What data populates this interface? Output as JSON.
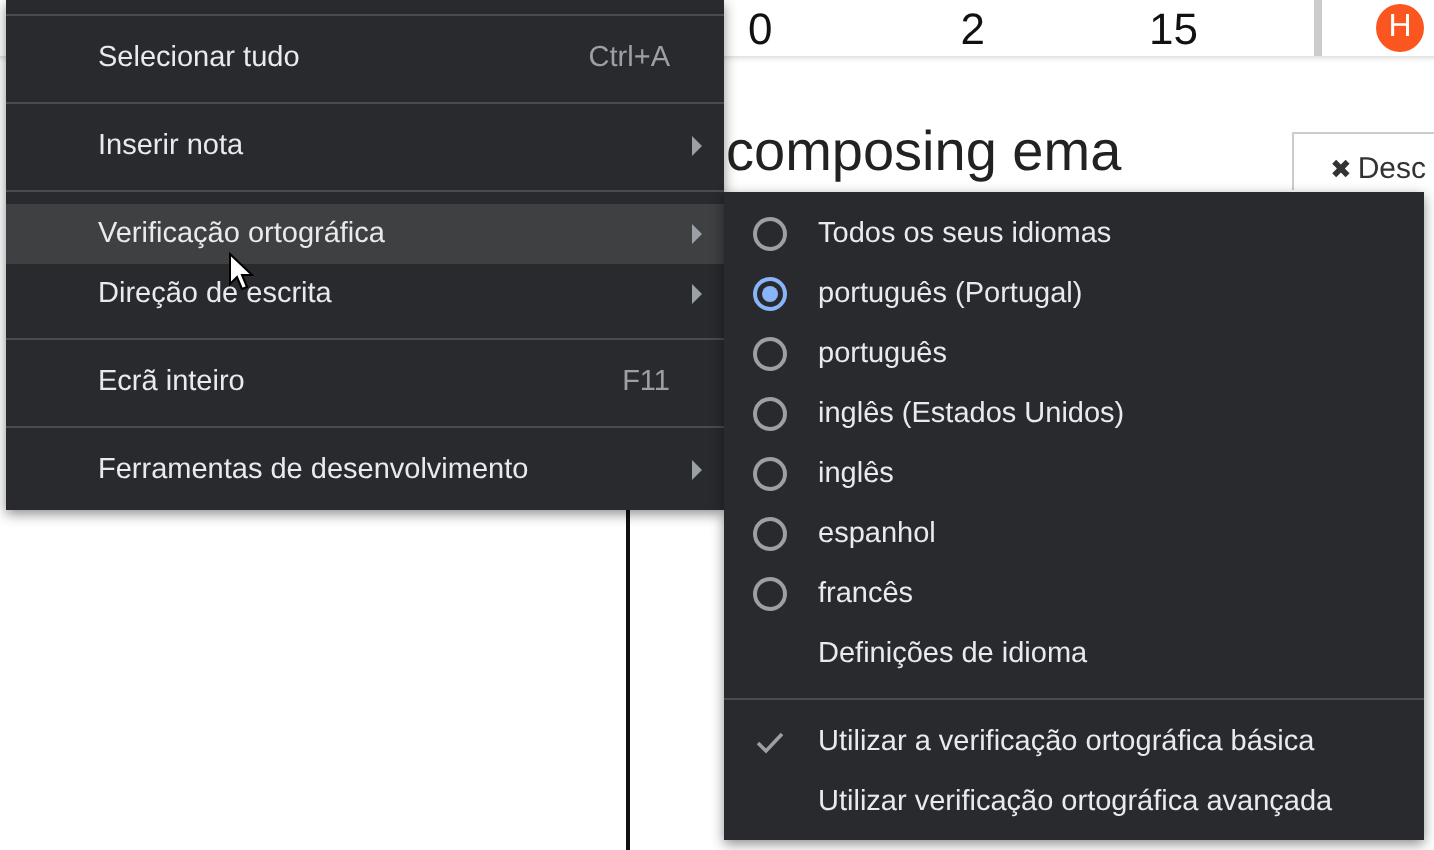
{
  "header": {
    "counters": [
      "0",
      "2",
      "15"
    ],
    "avatar": "H"
  },
  "heading": "composing ema",
  "discard_button": {
    "icon": "✖",
    "label": "Desc"
  },
  "context_menu": {
    "items": [
      {
        "kind": "separator"
      },
      {
        "kind": "item",
        "label": "Selecionar tudo",
        "shortcut": "Ctrl+A",
        "submenu": false,
        "highlighted": false
      },
      {
        "kind": "separator"
      },
      {
        "kind": "item",
        "label": "Inserir nota",
        "submenu": true,
        "highlighted": false
      },
      {
        "kind": "separator"
      },
      {
        "kind": "item",
        "label": "Verificação ortográfica",
        "submenu": true,
        "highlighted": true
      },
      {
        "kind": "item",
        "label": "Direção de escrita",
        "submenu": true,
        "highlighted": false
      },
      {
        "kind": "separator"
      },
      {
        "kind": "item",
        "label": "Ecrã inteiro",
        "shortcut": "F11",
        "submenu": false,
        "highlighted": false
      },
      {
        "kind": "separator"
      },
      {
        "kind": "item",
        "label": "Ferramentas de desenvolvimento",
        "submenu": true,
        "highlighted": false
      }
    ]
  },
  "spellcheck_submenu": {
    "items": [
      {
        "kind": "radio",
        "label": "Todos os seus idiomas",
        "selected": false
      },
      {
        "kind": "radio",
        "label": "português (Portugal)",
        "selected": true
      },
      {
        "kind": "radio",
        "label": "português",
        "selected": false
      },
      {
        "kind": "radio",
        "label": "inglês (Estados Unidos)",
        "selected": false
      },
      {
        "kind": "radio",
        "label": "inglês",
        "selected": false
      },
      {
        "kind": "radio",
        "label": "espanhol",
        "selected": false
      },
      {
        "kind": "radio",
        "label": "francês",
        "selected": false
      },
      {
        "kind": "item",
        "label": "Definições de idioma"
      },
      {
        "kind": "separator"
      },
      {
        "kind": "check",
        "label": "Utilizar a verificação ortográfica básica",
        "checked": true
      },
      {
        "kind": "check",
        "label": "Utilizar verificação ortográfica avançada",
        "checked": false
      }
    ]
  }
}
